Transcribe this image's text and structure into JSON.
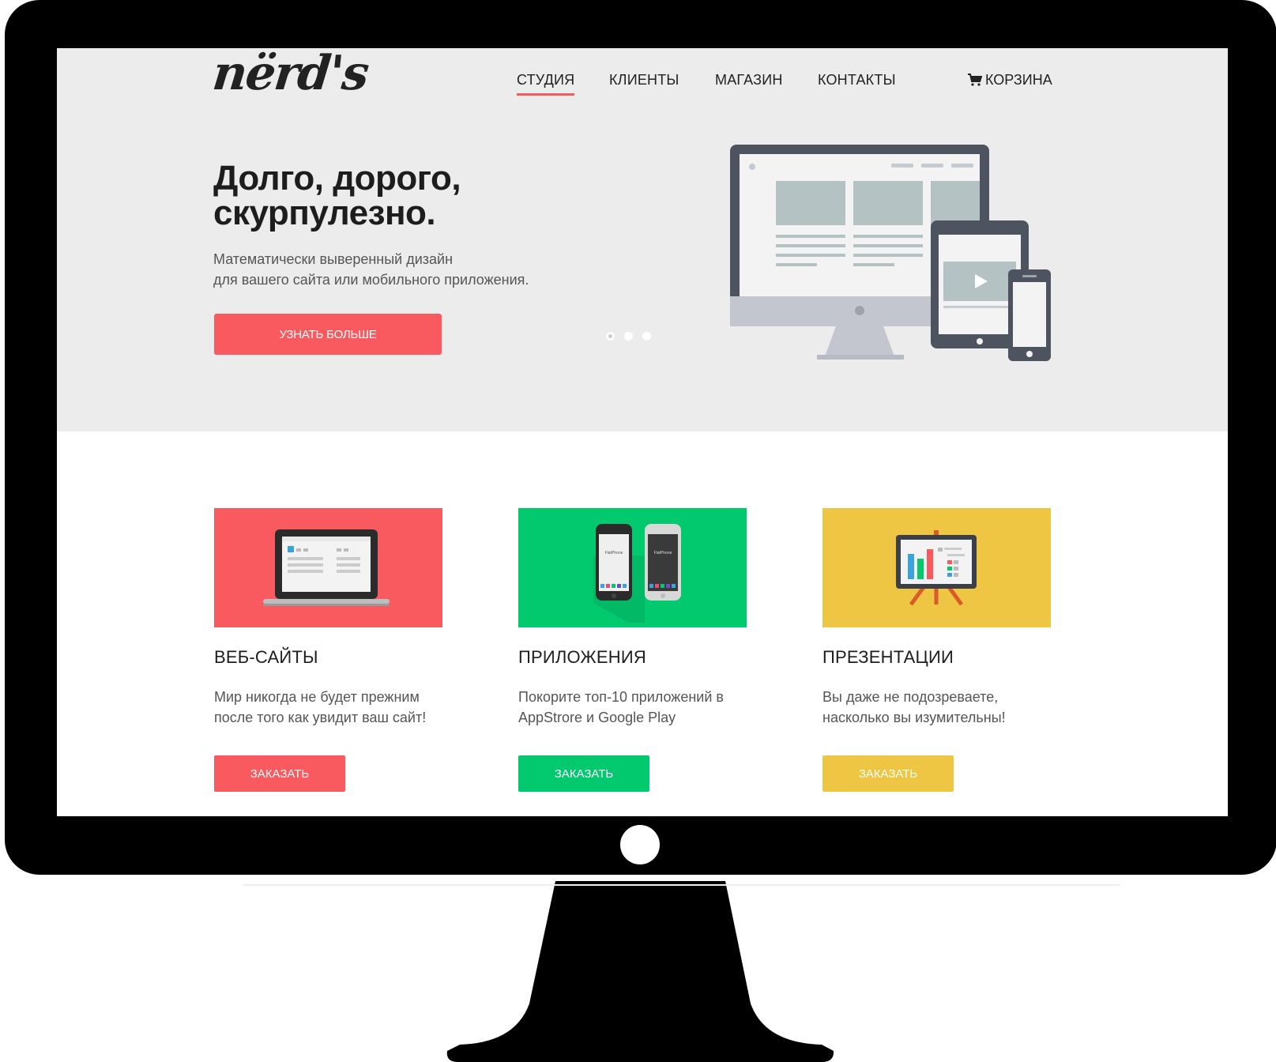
{
  "logo": {
    "text": "nërd's"
  },
  "nav": {
    "items": [
      {
        "label": "СТУДИЯ",
        "active": true
      },
      {
        "label": "КЛИЕНТЫ",
        "active": false
      },
      {
        "label": "МАГАЗИН",
        "active": false
      },
      {
        "label": "КОНТАКТЫ",
        "active": false
      }
    ],
    "cart_label": "КОРЗИНА",
    "cart_icon": "cart-icon"
  },
  "hero": {
    "title": "Долго, дорого,\nскурпулезно.",
    "subtitle": "Математически выверенный дизайн\nдля вашего сайта или мобильного приложения.",
    "button_label": "УЗНАТЬ БОЛЬШЕ",
    "slides": 3,
    "active_slide": 1,
    "illustration": "responsive-devices-illustration"
  },
  "services": [
    {
      "title": "ВЕБ-САЙТЫ",
      "text": "Мир никогда не будет прежним\nпосле того как увидит ваш сайт!",
      "button_label": "ЗАКАЗАТЬ",
      "color": "#f95a5f",
      "icon": "laptop-icon"
    },
    {
      "title": "ПРИЛОЖЕНИЯ",
      "text": "Покорите топ-10 приложений в\nAppStrore и Google Play",
      "button_label": "ЗАКАЗАТЬ",
      "color": "#03c96e",
      "icon": "phones-icon",
      "phone_label": "FlatPhone"
    },
    {
      "title": "ПРЕЗЕНТАЦИИ",
      "text": "Вы даже не подозреваете,\nнасколько вы изумительны!",
      "button_label": "ЗАКАЗАТЬ",
      "color": "#eec643",
      "icon": "presentation-board-icon"
    }
  ],
  "colors": {
    "accent": "#f95a5f",
    "hero_bg": "#ececec",
    "green": "#03c96e",
    "yellow": "#eec643",
    "bezel": "#000000"
  }
}
